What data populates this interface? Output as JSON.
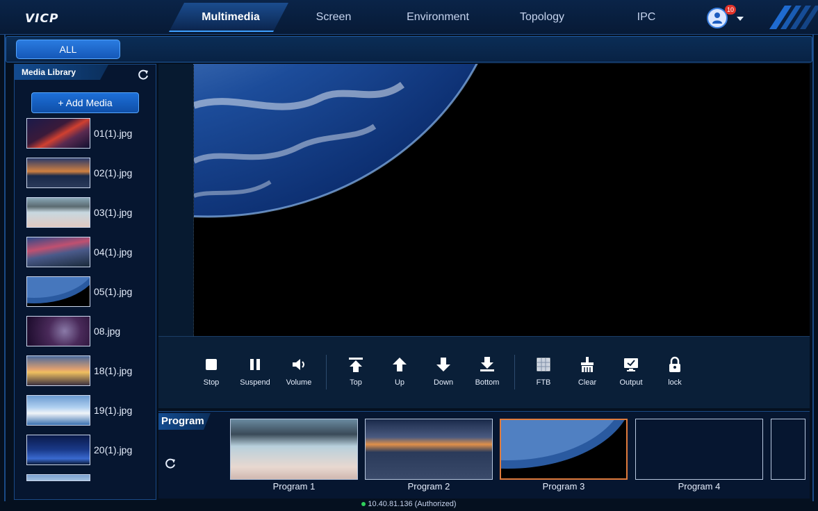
{
  "app": {
    "logo": "VICP"
  },
  "nav": {
    "tabs": [
      {
        "label": "Multimedia",
        "active": true
      },
      {
        "label": "Screen",
        "active": false
      },
      {
        "label": "Environment",
        "active": false
      },
      {
        "label": "Topology",
        "active": false
      },
      {
        "label": "IPC",
        "active": false
      }
    ],
    "notification_count": "10"
  },
  "subbar": {
    "all_label": "ALL"
  },
  "media_library": {
    "title": "Media Library",
    "add_label": "+ Add Media",
    "items": [
      {
        "name": "01(1).jpg"
      },
      {
        "name": "02(1).jpg"
      },
      {
        "name": "03(1).jpg"
      },
      {
        "name": "04(1).jpg"
      },
      {
        "name": "05(1).jpg"
      },
      {
        "name": "08.jpg"
      },
      {
        "name": "18(1).jpg"
      },
      {
        "name": "19(1).jpg"
      },
      {
        "name": "20(1).jpg"
      }
    ]
  },
  "toolbar": {
    "stop": "Stop",
    "suspend": "Suspend",
    "volume": "Volume",
    "top": "Top",
    "up": "Up",
    "down": "Down",
    "bottom": "Bottom",
    "ftb": "FTB",
    "clear": "Clear",
    "output": "Output",
    "lock": "lock"
  },
  "program": {
    "title": "Program",
    "cards": [
      {
        "label": "Program 1"
      },
      {
        "label": "Program 2"
      },
      {
        "label": "Program 3",
        "selected": true
      },
      {
        "label": "Program 4"
      }
    ]
  },
  "status": {
    "text": "10.40.81.136 (Authorized)"
  },
  "colors": {
    "accent": "#2e93ff",
    "selected_border": "#e07b3c",
    "status_ok": "#2fd05a"
  }
}
